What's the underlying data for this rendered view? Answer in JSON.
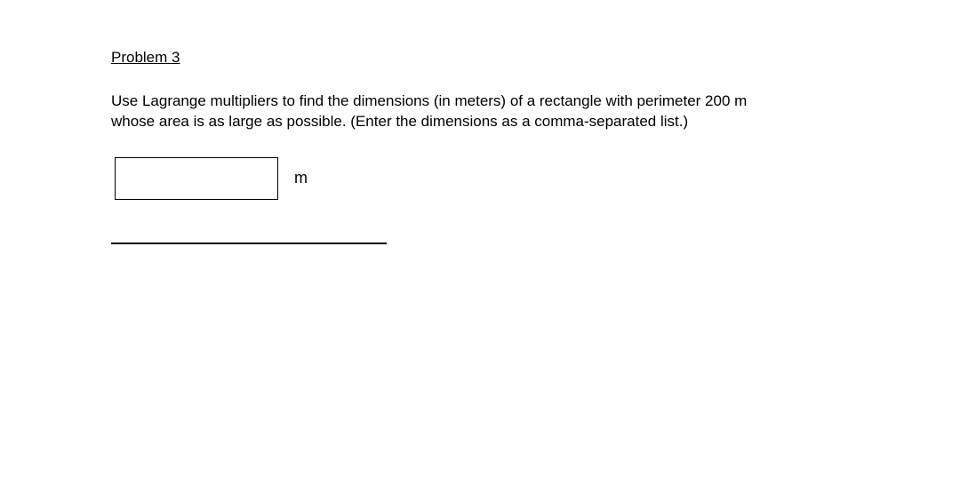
{
  "problem": {
    "title": "Problem 3",
    "statement": "Use Lagrange multipliers to find the dimensions (in meters) of a rectangle with perimeter 200 m whose area is as large as possible. (Enter the dimensions as a comma-separated list.)",
    "unit": "m",
    "answer_value": ""
  }
}
